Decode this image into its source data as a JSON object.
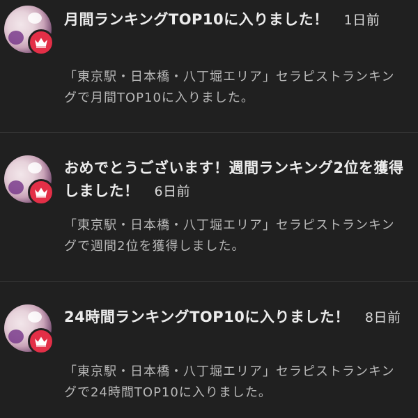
{
  "notifications": [
    {
      "title": "月間ランキングTOP10に入りました！",
      "time": "1日前",
      "message": "「東京駅・日本橋・八丁堀エリア」セラピストランキングで月間TOP10に入りました。",
      "badge_icon": "crown-icon",
      "badge_color": "#e32f47"
    },
    {
      "title": "おめでとうございます！週間ランキング2位を獲得しました！",
      "time": "6日前",
      "message": "「東京駅・日本橋・八丁堀エリア」セラピストランキングで週間2位を獲得しました。",
      "badge_icon": "crown-icon",
      "badge_color": "#e32f47"
    },
    {
      "title": "24時間ランキングTOP10に入りました！",
      "time": "8日前",
      "message": "「東京駅・日本橋・八丁堀エリア」セラピストランキングで24時間TOP10に入りました。",
      "badge_icon": "crown-icon",
      "badge_color": "#e32f47"
    }
  ]
}
